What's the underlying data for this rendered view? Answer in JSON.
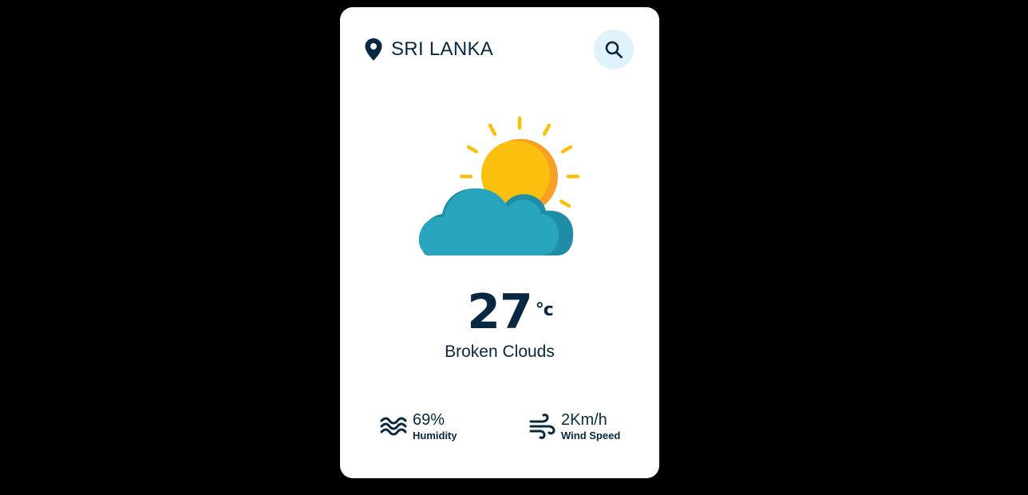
{
  "header": {
    "location": "SRI LANKA",
    "location_icon": "map-pin-icon",
    "search_icon": "search-icon"
  },
  "weather": {
    "icon": "sun-behind-cloud-icon",
    "temperature": "27",
    "unit": "°c",
    "description": "Broken Clouds"
  },
  "stats": {
    "humidity": {
      "value": "69%",
      "label": "Humidity",
      "icon": "waves-icon"
    },
    "wind": {
      "value": "2Km/h",
      "label": "Wind Speed",
      "icon": "wind-icon"
    }
  },
  "colors": {
    "background": "#000000",
    "card": "#ffffff",
    "text": "#072840",
    "search_bg": "#e0f3fc",
    "sun": "#fbbf0e",
    "sun_shade": "#f8a023",
    "cloud": "#29a4bd",
    "cloud_shade": "#1f8ca8"
  }
}
